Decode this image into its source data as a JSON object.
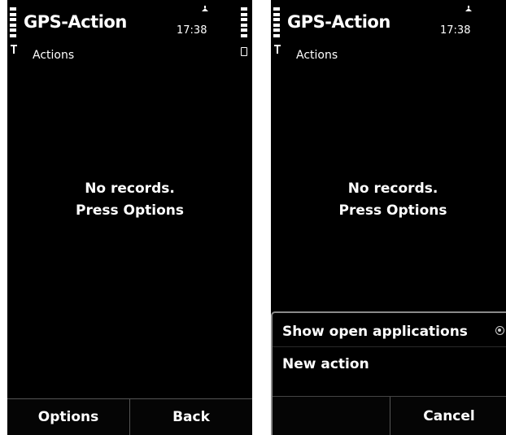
{
  "screens": [
    {
      "title": "GPS-Action",
      "clock": "17:38",
      "subtitle": "Actions",
      "empty_line1": "No records.",
      "empty_line2": "Press Options",
      "softkeys": {
        "left": "Options",
        "right": "Back"
      }
    },
    {
      "title": "GPS-Action",
      "clock": "17:38",
      "subtitle": "Actions",
      "empty_line1": "No records.",
      "empty_line2": "Press Options",
      "menu": {
        "items": [
          "Show open applications",
          "New action"
        ],
        "softkeys": {
          "left": "",
          "right": "Cancel"
        }
      }
    }
  ]
}
